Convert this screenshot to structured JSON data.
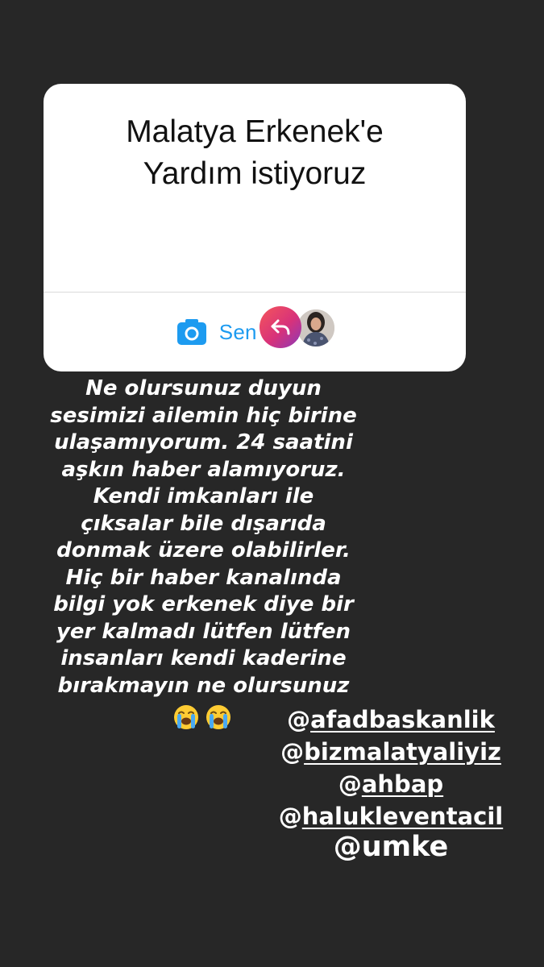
{
  "question_card": {
    "title_lines": [
      "Malatya Erkenek'e",
      "Yardım istiyoruz"
    ],
    "add_button_label": "Sen de Ekle",
    "reply_icon": "reply-arrow-icon",
    "camera_icon": "camera-icon",
    "accent_color": "#1d9bf0"
  },
  "message": {
    "lines": [
      "Ne olursunuz duyun",
      "sesimizi ailemin hiç birine",
      "ulaşamıyorum. 24 saatini",
      "aşkın haber alamıyoruz.",
      "Kendi imkanları ile",
      "çıksalar bile dışarıda",
      "donmak üzere olabilirler.",
      "Hiç bir haber kanalında",
      "bilgi yok erkenek diye bir",
      "yer kalmadı lütfen lütfen",
      "insanları kendi kaderine",
      "bırakmayın ne olursunuz"
    ],
    "emojis": [
      "loudly-crying-face",
      "loudly-crying-face"
    ]
  },
  "mentions": [
    {
      "at": "@",
      "handle": "afadbaskanlik",
      "underlined": true
    },
    {
      "at": "@",
      "handle": "bizmalatyaliyiz",
      "underlined": true
    },
    {
      "at": "@",
      "handle": "ahbap",
      "underlined": true
    },
    {
      "at": "@",
      "handle": "halukleventacil",
      "underlined": true
    },
    {
      "at": "@",
      "handle": "umke",
      "underlined": false
    }
  ]
}
